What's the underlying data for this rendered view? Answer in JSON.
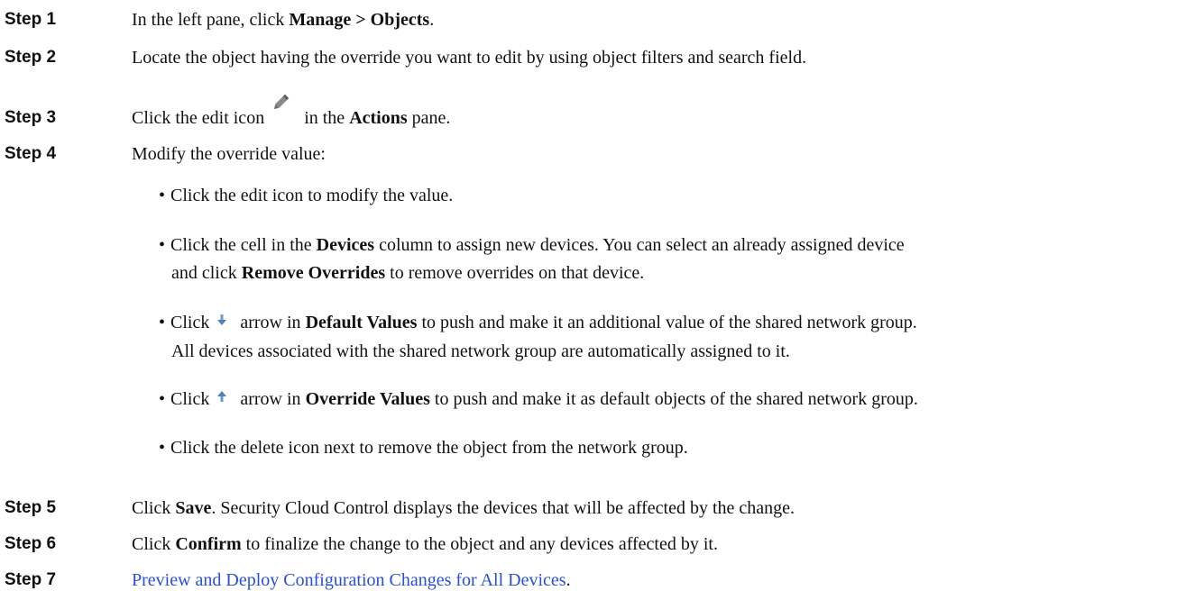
{
  "steps": [
    {
      "label": "Step 1",
      "p1": "In the left pane, click ",
      "b1": "Manage > Objects",
      "p2": "."
    },
    {
      "label": "Step 2",
      "text": "Locate the object having the override you want to edit by using object filters and search field."
    },
    {
      "label": "Step 3",
      "p1": "Click the edit icon ",
      "p2": " in the ",
      "b1": "Actions",
      "p3": " pane."
    },
    {
      "label": "Step 4",
      "text": "Modify the override value:"
    },
    {
      "label": "Step 5",
      "p1": "Click ",
      "b1": "Save",
      "p2": ". Security Cloud Control displays the devices that will be affected by the change."
    },
    {
      "label": "Step 6",
      "p1": "Click ",
      "b1": "Confirm",
      "p2": " to finalize the change to the object and any devices affected by it."
    },
    {
      "label": "Step 7",
      "link": "Preview and Deploy Configuration Changes for All Devices",
      "p2": "."
    }
  ],
  "bullets": {
    "b1": {
      "text": "Click the edit icon to modify the value."
    },
    "b2": {
      "p1": "Click the cell in the ",
      "b1": "Devices",
      "p2": " column to assign new devices. You can select an already assigned device",
      "c1": "and click ",
      "b2": "Remove Overrides",
      "c2": " to remove overrides on that device."
    },
    "b3": {
      "p1": "Click ",
      "p2": " arrow in ",
      "b1": "Default Values",
      "p3": " to push and make it an additional value of the shared network group.",
      "c1": "All devices associated with the shared network group are automatically assigned to it."
    },
    "b4": {
      "p1": "Click ",
      "p2": " arrow in ",
      "b1": "Override Values",
      "p3": " to push and make it as default objects of the shared network group."
    },
    "b5": {
      "text": "Click the delete icon next to remove the object from the network group."
    }
  },
  "bullet_glyph": "•",
  "colors": {
    "link": "#2a4fd8",
    "text": "#111111"
  }
}
